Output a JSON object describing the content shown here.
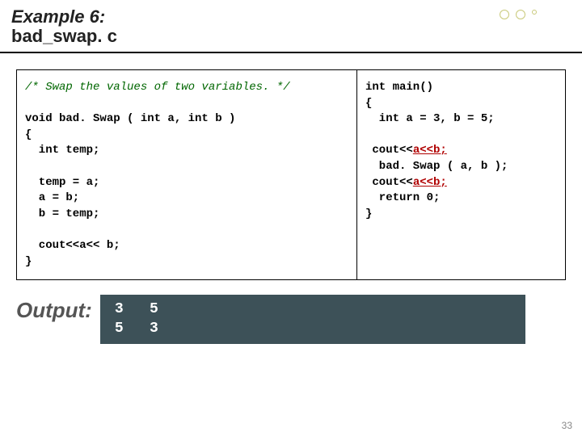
{
  "header": {
    "line1": "Example 6:",
    "line2": "bad_swap. c"
  },
  "left": {
    "comment": "/* Swap the values of two variables. */",
    "l1": "void bad. Swap ( int a, int b )",
    "l2": "{",
    "l3": "  int temp;",
    "blank": "",
    "l4": "  temp = a;",
    "l5": "  a = b;",
    "l6": "  b = temp;",
    "l7": "  cout<<a<< b;",
    "l8": "}"
  },
  "right": {
    "r1": "int main()",
    "r2": "{",
    "r3": "  int a = 3, b = 5;",
    "blank": "",
    "r4a": " cout<<",
    "r4link": "a<<b;",
    "r5": "  bad. Swap ( a, b );",
    "r6a": " cout<<",
    "r6link": "a<<b;",
    "r7": "  return 0;",
    "r8": "}"
  },
  "output": {
    "label": "Output:",
    "row1": "3   5",
    "row2": "5   3"
  },
  "page": "33"
}
